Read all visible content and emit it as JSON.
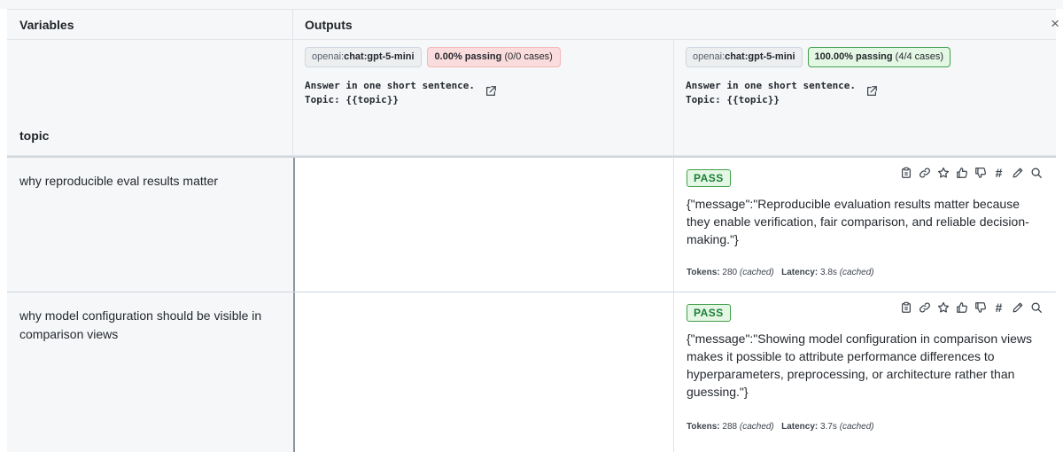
{
  "header": {
    "variables_label": "Variables",
    "outputs_label": "Outputs",
    "close_glyph": "×"
  },
  "variables": {
    "column_name": "topic"
  },
  "providers": [
    {
      "provider_prefix": "openai:",
      "model": "chat:gpt-5-mini",
      "pass_percent": "0.00% passing",
      "pass_cases": "(0/0 cases)",
      "prompt_line1": "Answer in one short sentence.",
      "prompt_line2": "Topic: {{topic}}",
      "status_color": "#fbdcdc"
    },
    {
      "provider_prefix": "openai:",
      "model": "chat:gpt-5-mini",
      "pass_percent": "100.00% passing",
      "pass_cases": "(4/4 cases)",
      "prompt_line1": "Answer in one short sentence.",
      "prompt_line2": "Topic: {{topic}}",
      "status_color": "#e4f7e4"
    }
  ],
  "rows": [
    {
      "topic": "why reproducible eval results matter",
      "output": {
        "status": "PASS",
        "message": "{\"message\":\"Reproducible evaluation results matter because they enable verification, fair comparison, and reliable decision-making.\"}",
        "tokens_label": "Tokens:",
        "tokens": "280",
        "tokens_note": "(cached)",
        "latency_label": "Latency:",
        "latency": "3.8s",
        "latency_note": "(cached)"
      }
    },
    {
      "topic": "why model configuration should be visible in comparison views",
      "output": {
        "status": "PASS",
        "message": "{\"message\":\"Showing model configuration in comparison views makes it possible to attribute performance differences to hyperparameters, preprocessing, or architecture rather than guessing.\"}",
        "tokens_label": "Tokens:",
        "tokens": "288",
        "tokens_note": "(cached)",
        "latency_label": "Latency:",
        "latency": "3.7s",
        "latency_note": "(cached)"
      }
    }
  ],
  "action_icons": [
    "copy-icon",
    "link-icon",
    "star-icon",
    "thumbs-up-icon",
    "thumbs-down-icon",
    "hash-icon",
    "pencil-icon",
    "search-icon"
  ],
  "colors": {
    "pass_green": "#1a7f37",
    "pass_border": "#41a04b",
    "header_bg": "#f6f7f8"
  }
}
